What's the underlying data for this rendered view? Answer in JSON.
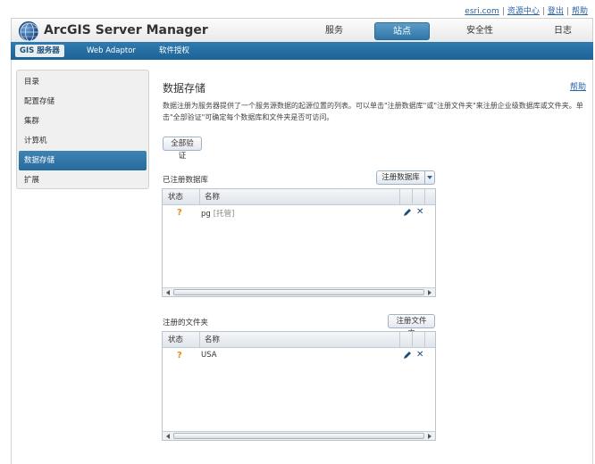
{
  "top_links": [
    "esri.com",
    "资源中心",
    "登出",
    "帮助"
  ],
  "app": {
    "title": "ArcGIS Server Manager"
  },
  "main_nav": [
    {
      "label": "服务",
      "active": false
    },
    {
      "label": "站点",
      "active": true
    },
    {
      "label": "安全性",
      "active": false
    },
    {
      "label": "日志",
      "active": false
    }
  ],
  "sub_nav": [
    {
      "label": "GIS 服务器",
      "active": true
    },
    {
      "label": "Web Adaptor",
      "active": false
    },
    {
      "label": "软件授权",
      "active": false
    }
  ],
  "sidebar": {
    "items": [
      {
        "label": "目录",
        "active": false
      },
      {
        "label": "配置存储",
        "active": false
      },
      {
        "label": "集群",
        "active": false
      },
      {
        "label": "计算机",
        "active": false
      },
      {
        "label": "数据存储",
        "active": true
      },
      {
        "label": "扩展",
        "active": false
      }
    ]
  },
  "main": {
    "title": "数据存储",
    "help": "帮助",
    "description": "数据注册为服务器提供了一个服务源数据的起源位置的列表。可以单击\"注册数据库\"或\"注册文件夹\"来注册企业级数据库或文件夹。单击\"全部验证\"可确定每个数据库和文件夹是否可访问。",
    "verify_all": "全部验证",
    "databases": {
      "label": "已注册数据库",
      "register_button": "注册数据库",
      "columns": {
        "status": "状态",
        "name": "名称"
      },
      "rows": [
        {
          "status": "?",
          "name": "pg",
          "tag": "[托管]"
        }
      ]
    },
    "folders": {
      "label": "注册的文件夹",
      "register_button": "注册文件夹",
      "columns": {
        "status": "状态",
        "name": "名称"
      },
      "rows": [
        {
          "status": "?",
          "name": "USA"
        }
      ]
    }
  },
  "colors": {
    "accent": "#2f76a8",
    "status_unknown": "#e8891c",
    "link": "#2a63a6"
  }
}
